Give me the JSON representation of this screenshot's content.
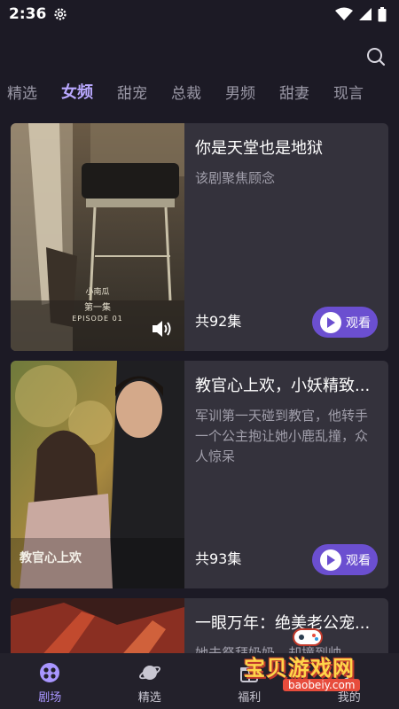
{
  "status": {
    "time": "2:36"
  },
  "tabs": [
    {
      "label": "精选"
    },
    {
      "label": "女频",
      "active": true
    },
    {
      "label": "甜宠"
    },
    {
      "label": "总裁"
    },
    {
      "label": "男频"
    },
    {
      "label": "甜妻"
    },
    {
      "label": "现言"
    }
  ],
  "cards": [
    {
      "title": "你是天堂也是地狱",
      "desc": "该剧聚焦顾念",
      "count": "共92集",
      "watch": "观看",
      "cover_caption_name": "小南瓜",
      "cover_caption_ep": "第一集",
      "cover_caption_en": "EPISODE 01"
    },
    {
      "title": "教官心上欢，小妖精致...",
      "desc": "军训第一天碰到教官，他转手一个公主抱让她小鹿乱撞，众人惊呆",
      "count": "共93集",
      "watch": "观看",
      "cover_caption_title": "教官心上欢"
    },
    {
      "title": "一眼万年：绝美老公宠...",
      "desc": "她去祭拜奶奶，却撞到帅"
    }
  ],
  "nav": [
    {
      "label": "剧场",
      "icon": "theater-icon",
      "active": true
    },
    {
      "label": "精选",
      "icon": "planet-icon"
    },
    {
      "label": "福利",
      "icon": "gift-icon"
    },
    {
      "label": "我的",
      "icon": "profile-icon"
    }
  ],
  "watermark": {
    "text": "宝贝游戏网",
    "url": "baobeiy.com"
  },
  "colors": {
    "accent": "#b9a8ff",
    "button": "#6b4fd0",
    "card_bg": "#34323c",
    "page_bg": "#1c1a25"
  }
}
